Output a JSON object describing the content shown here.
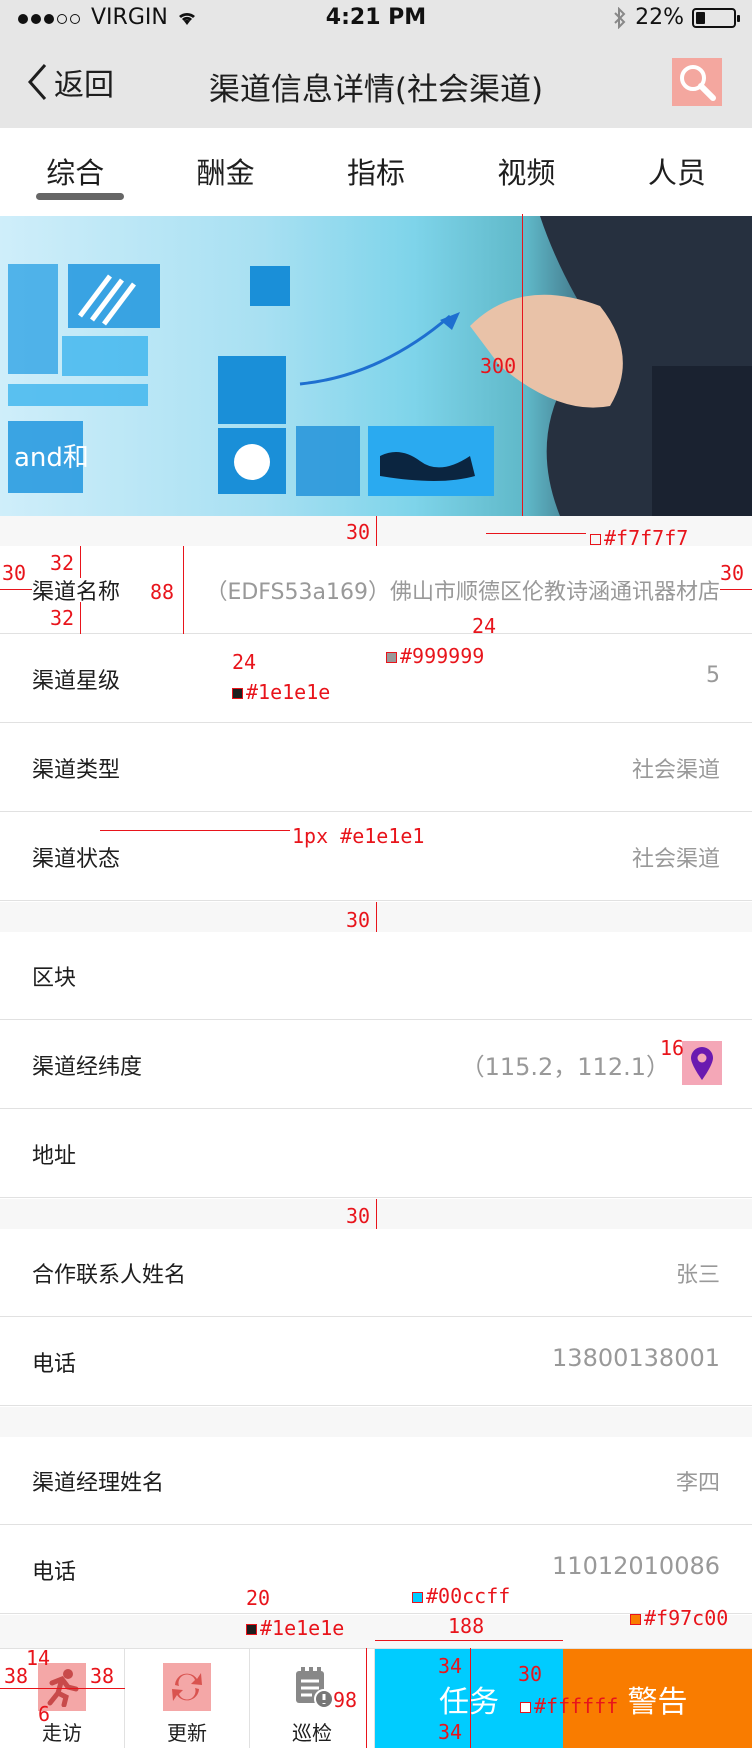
{
  "status_bar": {
    "carrier": "VIRGIN",
    "time": "4:21 PM",
    "battery": "22%",
    "battery_level": 0.22
  },
  "nav": {
    "back_label": "返回",
    "title": "渠道信息详情(社会渠道)"
  },
  "tabs": [
    {
      "label": "综合",
      "active": true
    },
    {
      "label": "酬金",
      "active": false
    },
    {
      "label": "指标",
      "active": false
    },
    {
      "label": "视频",
      "active": false
    },
    {
      "label": "人员",
      "active": false
    }
  ],
  "section1": [
    {
      "label": "渠道名称",
      "value": "（EDFS53a169）佛山市顺德区伦教诗涵通讯器材店"
    },
    {
      "label": "渠道星级",
      "value": "5"
    },
    {
      "label": "渠道类型",
      "value": "社会渠道"
    },
    {
      "label": "渠道状态",
      "value": "社会渠道"
    }
  ],
  "section2": [
    {
      "label": "区块",
      "value": ""
    },
    {
      "label": "渠道经纬度",
      "value": "（115.2，112.1）"
    },
    {
      "label": "地址",
      "value": ""
    }
  ],
  "section3": [
    {
      "label": "合作联系人姓名",
      "value": "张三"
    },
    {
      "label": "电话",
      "value": "13800138001"
    }
  ],
  "section4": [
    {
      "label": "渠道经理姓名",
      "value": "李四"
    },
    {
      "label": "电话",
      "value": "11012010086"
    }
  ],
  "bottom_bar": {
    "visit": "走访",
    "update": "更新",
    "inspect": "巡检",
    "task": "任务",
    "warning": "警告"
  },
  "annotations": {
    "banner_height": "300",
    "gap_30": "30",
    "bg_color": "#f7f7f7",
    "pad_left": "30",
    "pad_right": "30",
    "top_32": "32",
    "bottom_32": "32",
    "row_88": "88",
    "font_24a": "24",
    "font_24b": "24",
    "value_color": "#999999",
    "label_color": "#1e1e1e",
    "divider": "1px #e1e1e1",
    "gap_30b": "30",
    "icon_16": "16",
    "gap_30c": "30",
    "tab_font_20": "20",
    "tab_color": "#1e1e1e",
    "task_color": "#00ccff",
    "task_width": "188",
    "warn_color": "#f97c00",
    "bb_14": "14",
    "bb_38a": "38",
    "bb_38b": "38",
    "bb_6": "6",
    "bb_34a": "34",
    "bb_34b": "34",
    "bb_30": "30",
    "bb_98": "98",
    "white": "#ffffff"
  },
  "colors": {
    "gap_bg": "#f7f7f7",
    "value": "#999999",
    "label": "#1e1e1e",
    "divider": "#e1e1e1",
    "task": "#00ccff",
    "warning": "#f97c00"
  }
}
